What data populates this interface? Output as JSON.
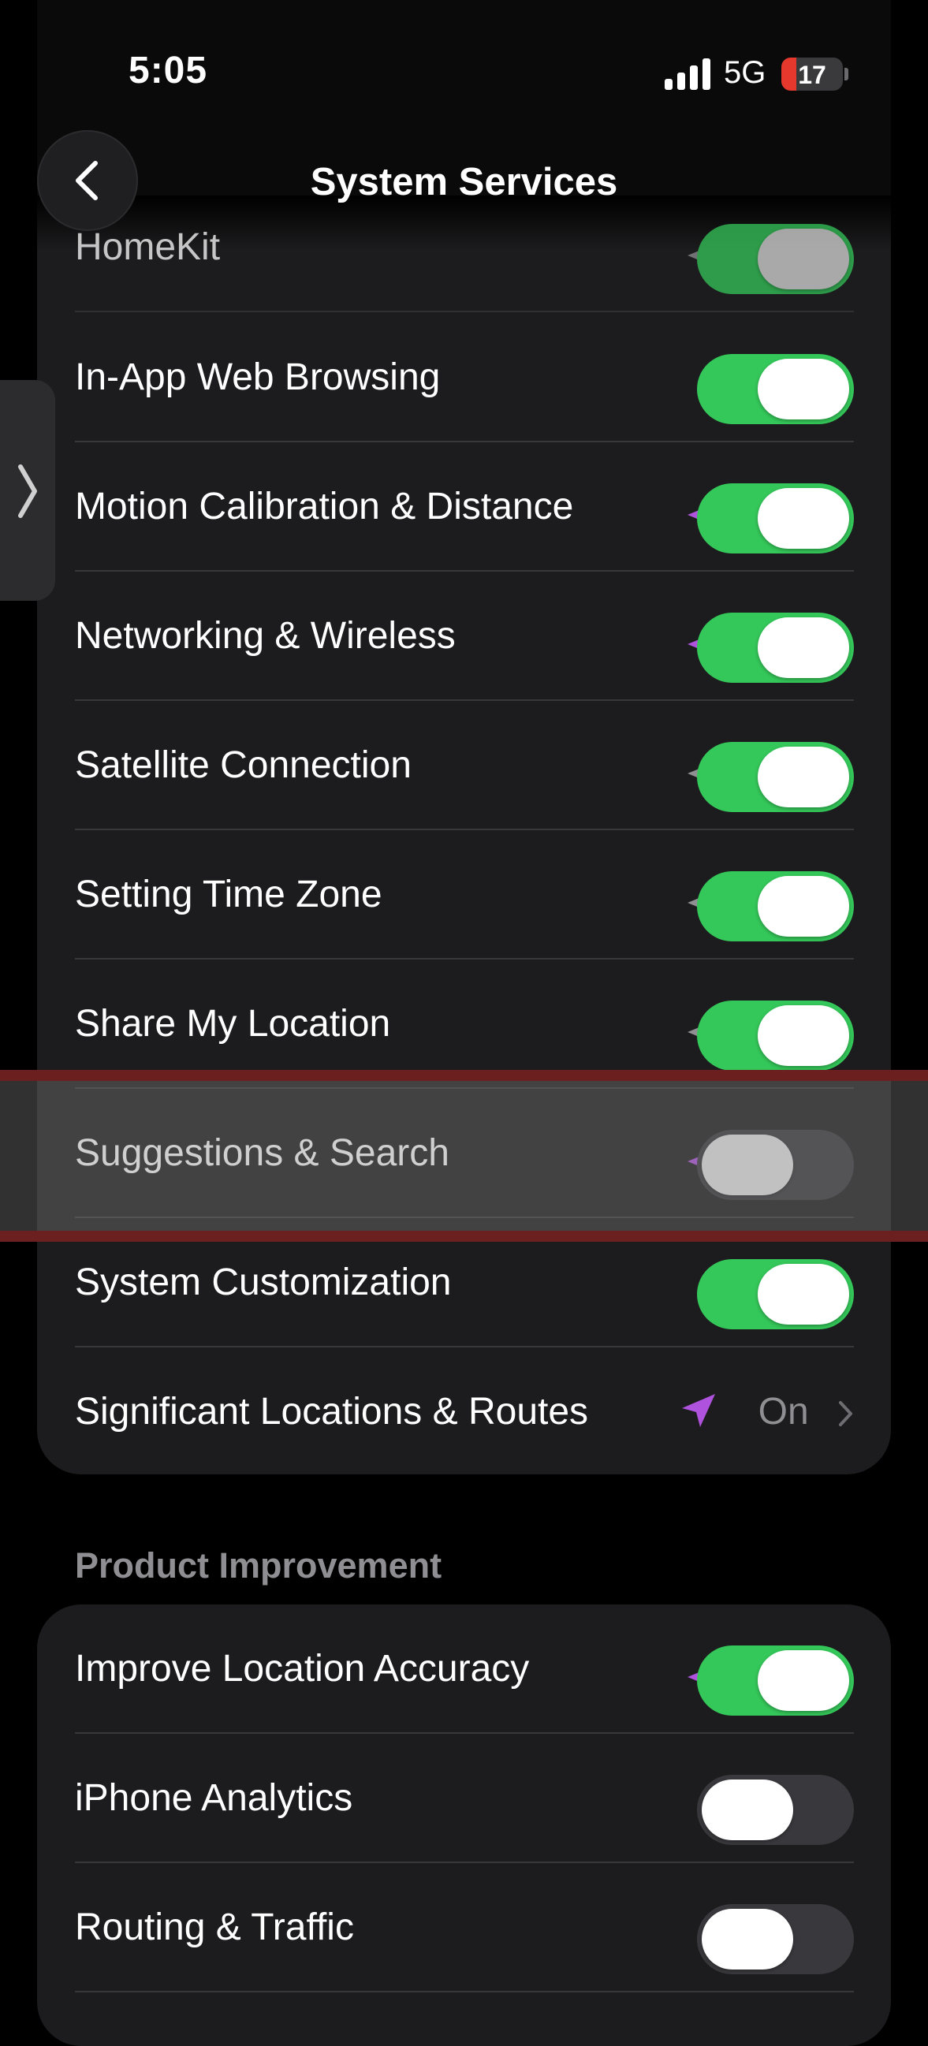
{
  "status_bar": {
    "time": "5:05",
    "network": "5G",
    "battery_level": "17",
    "battery_color": "#e6382d"
  },
  "nav": {
    "title": "System Services",
    "back_icon": "chevron-left-icon"
  },
  "side_handle": {
    "icon": "chevron-right-icon"
  },
  "system_services": [
    {
      "label": "HomeKit",
      "on": true,
      "location_indicator": "gray"
    },
    {
      "label": "In-App Web Browsing",
      "on": true,
      "location_indicator": "none"
    },
    {
      "label": "Motion Calibration & Distance",
      "on": true,
      "location_indicator": "purple"
    },
    {
      "label": "Networking & Wireless",
      "on": true,
      "location_indicator": "purple"
    },
    {
      "label": "Satellite Connection",
      "on": true,
      "location_indicator": "gray"
    },
    {
      "label": "Setting Time Zone",
      "on": true,
      "location_indicator": "gray"
    },
    {
      "label": "Share My Location",
      "on": true,
      "location_indicator": "gray"
    },
    {
      "label": "Suggestions & Search",
      "on": false,
      "location_indicator": "purple",
      "highlighted": true
    },
    {
      "label": "System Customization",
      "on": true,
      "location_indicator": "none"
    },
    {
      "label": "Significant Locations & Routes",
      "detail": "On",
      "icon": "location-arrow-icon",
      "accent": "#af52de"
    }
  ],
  "product_improvement": {
    "header": "Product Improvement",
    "items": [
      {
        "label": "Improve Location Accuracy",
        "on": true,
        "location_indicator": "purple"
      },
      {
        "label": "iPhone Analytics",
        "on": false,
        "location_indicator": "none"
      },
      {
        "label": "Routing & Traffic",
        "on": false,
        "location_indicator": "none"
      }
    ]
  },
  "colors": {
    "toggle_on": "#34c759",
    "toggle_off": "#39393d",
    "location_purple": "#af52de",
    "location_gray": "#8e8e93"
  }
}
